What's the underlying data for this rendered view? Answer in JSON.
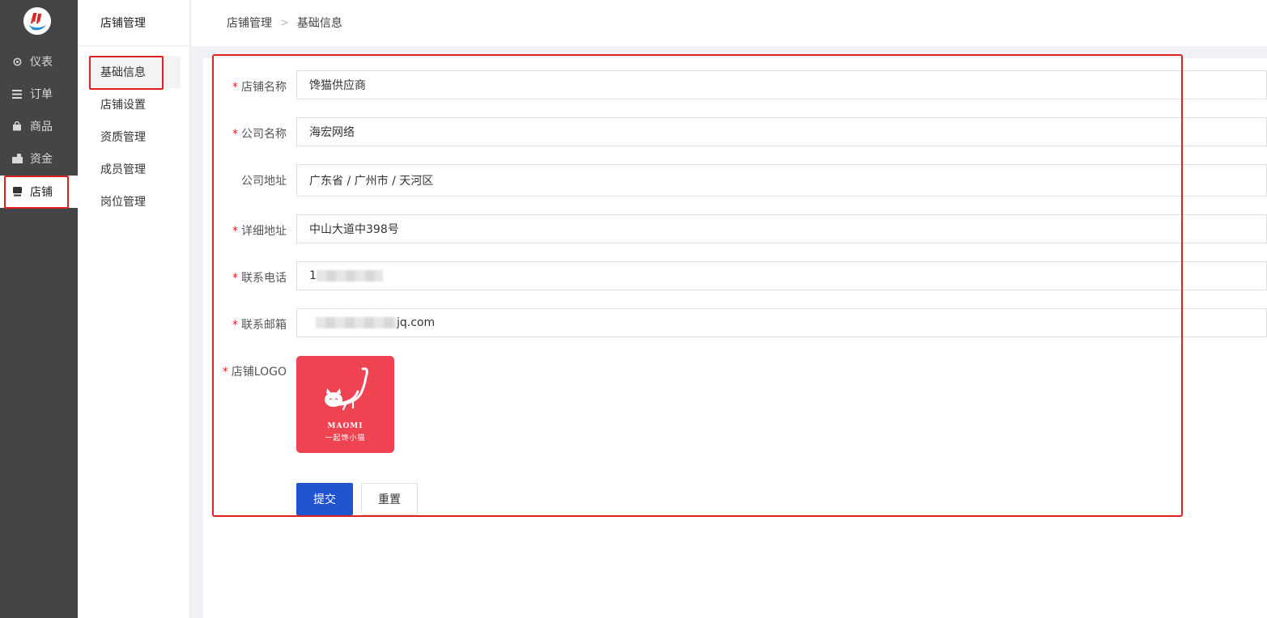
{
  "rail": {
    "items": [
      {
        "label": "仪表",
        "icon": "gear-icon"
      },
      {
        "label": "订单",
        "icon": "list-icon"
      },
      {
        "label": "商品",
        "icon": "bag-icon"
      },
      {
        "label": "资金",
        "icon": "wallet-icon"
      },
      {
        "label": "店铺",
        "icon": "store-icon",
        "active": true
      }
    ]
  },
  "sidebar": {
    "title": "店铺管理",
    "items": [
      {
        "label": "基础信息",
        "active": true
      },
      {
        "label": "店铺设置"
      },
      {
        "label": "资质管理"
      },
      {
        "label": "成员管理"
      },
      {
        "label": "岗位管理"
      }
    ]
  },
  "breadcrumb": {
    "parent": "店铺管理",
    "separator": ">",
    "current": "基础信息"
  },
  "form": {
    "store_name": {
      "label": "店铺名称",
      "required": true,
      "value": "馋猫供应商"
    },
    "company_name": {
      "label": "公司名称",
      "required": true,
      "value": "海宏网络"
    },
    "company_address": {
      "label": "公司地址",
      "required": false,
      "value": "广东省 / 广州市 / 天河区"
    },
    "detail_address": {
      "label": "详细地址",
      "required": true,
      "value": "中山大道中398号"
    },
    "phone": {
      "label": "联系电话",
      "required": true,
      "value": "1"
    },
    "email": {
      "label": "联系邮箱",
      "required": true,
      "value": "jq.com"
    },
    "logo": {
      "label": "店铺LOGO",
      "required": true,
      "brand_text": "MAOMI",
      "brand_sub": "一起馋小猫"
    },
    "submit_label": "提交",
    "reset_label": "重置"
  },
  "colors": {
    "rail_bg": "#444546",
    "primary": "#1e54d0",
    "highlight": "#e02020",
    "logo_bg": "#f04352"
  }
}
